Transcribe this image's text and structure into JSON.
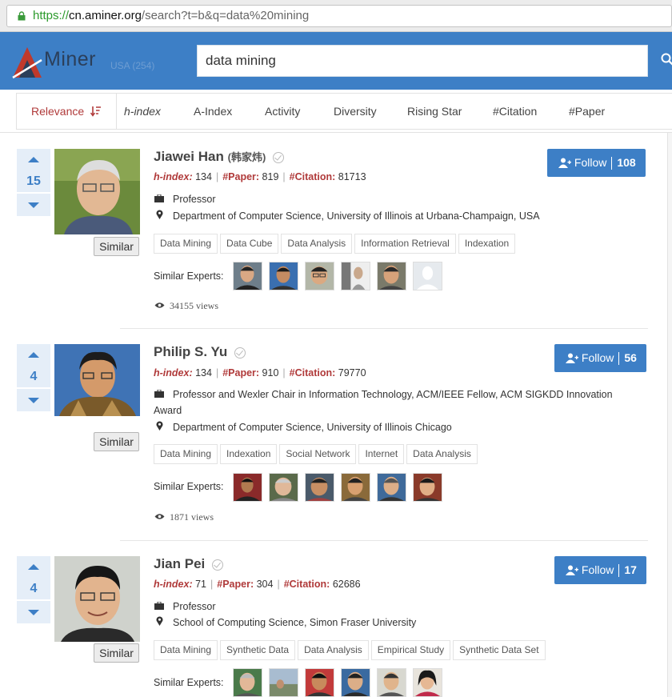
{
  "browser": {
    "url_protocol": "https://",
    "url_host": "cn.aminer.org",
    "url_path": "/search?t=b&q=data%20mining"
  },
  "header": {
    "logo_text": "Miner",
    "country": "USA (254)",
    "search_value": "data mining"
  },
  "sort_tabs": [
    "Relevance",
    "h-index",
    "A-Index",
    "Activity",
    "Diversity",
    "Rising Star",
    "#Citation",
    "#Paper"
  ],
  "labels": {
    "similar": "Similar",
    "similar_experts": "Similar Experts:",
    "follow": "Follow",
    "h_index": "h-index:",
    "paper": "#Paper:",
    "citation": "#Citation:"
  },
  "people": [
    {
      "name": "Jiawei Han",
      "name_cn": "(韩家炜)",
      "votes": "15",
      "h_index": "134",
      "papers": "819",
      "citations": "81713",
      "position": "Professor",
      "affiliation": "Department of Computer Science, University of Illinois at Urbana-Champaign, USA",
      "tags": [
        "Data Mining",
        "Data Cube",
        "Data Analysis",
        "Information Retrieval",
        "Indexation"
      ],
      "views": "34155 views",
      "followers": "108"
    },
    {
      "name": "Philip S. Yu",
      "name_cn": "",
      "votes": "4",
      "h_index": "134",
      "papers": "910",
      "citations": "79770",
      "position": "Professor and Wexler Chair in Information Technology, ACM/IEEE Fellow, ACM SIGKDD Innovation Award",
      "affiliation": "Department of Computer Science, University of Illinois Chicago",
      "tags": [
        "Data Mining",
        "Indexation",
        "Social Network",
        "Internet",
        "Data Analysis"
      ],
      "views": "1871 views",
      "followers": "56"
    },
    {
      "name": "Jian Pei",
      "name_cn": "",
      "votes": "4",
      "h_index": "71",
      "papers": "304",
      "citations": "62686",
      "position": "Professor",
      "affiliation": "School of Computing Science, Simon Fraser University",
      "tags": [
        "Data Mining",
        "Synthetic Data",
        "Data Analysis",
        "Empirical Study",
        "Synthetic Data Set"
      ],
      "views": "",
      "followers": "17"
    }
  ],
  "colors": {
    "brand_blue": "#3d7fc6",
    "accent_red": "#b03a3a"
  }
}
